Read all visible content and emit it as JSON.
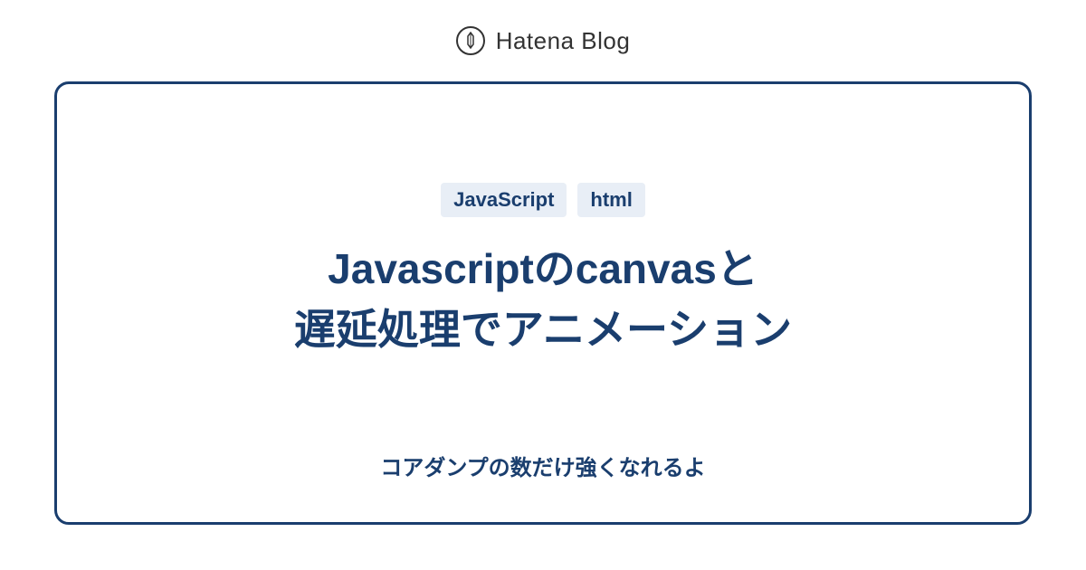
{
  "header": {
    "brand": "Hatena Blog"
  },
  "card": {
    "tags": [
      "JavaScript",
      "html"
    ],
    "title_line1": "Javascriptのcanvasと",
    "title_line2": "遅延処理でアニメーション",
    "subtitle": "コアダンプの数だけ強くなれるよ"
  },
  "colors": {
    "primary": "#1a3e6e",
    "tag_bg": "#e8eef6"
  }
}
